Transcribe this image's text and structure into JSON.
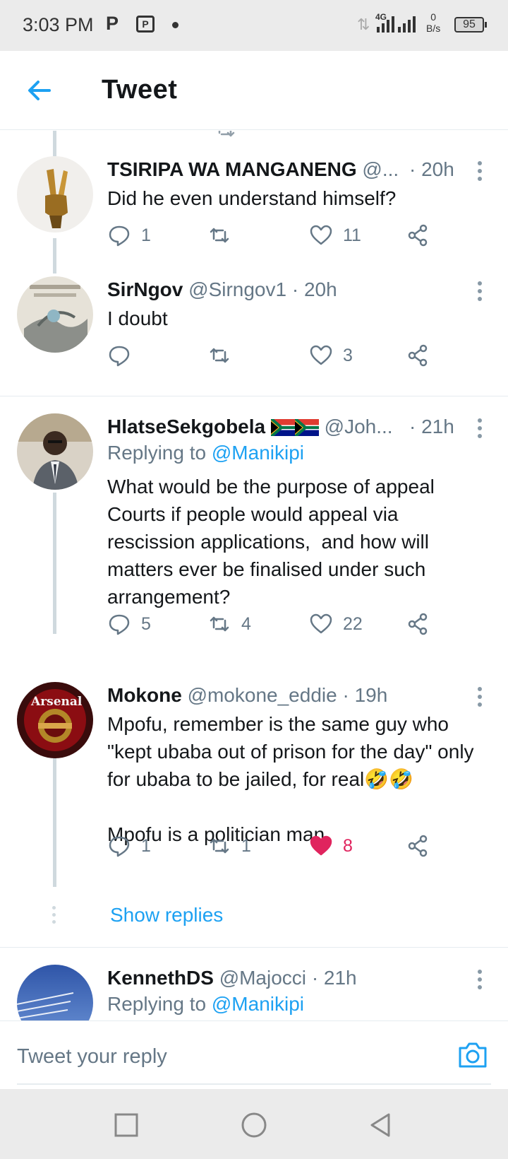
{
  "status_bar": {
    "time": "3:03 PM",
    "p_icon": "P",
    "network": "4G",
    "speed_value": "0",
    "speed_unit": "B/s",
    "battery": "95"
  },
  "header": {
    "title": "Tweet",
    "back_icon": "arrow-left-icon"
  },
  "tweets": [
    {
      "name": "TSIRIPA WA MANGANENG",
      "handle": "@...",
      "time": "· 20h",
      "text": "Did he even understand himself?",
      "replies": "1",
      "retweets": "",
      "likes": "11"
    },
    {
      "name": "SirNgov",
      "handle": "@Sirngov1",
      "time": "· 20h",
      "text": "I doubt",
      "replies": "",
      "retweets": "",
      "likes": "3"
    },
    {
      "name": "HlatseSekgobela",
      "handle": "@Joh...",
      "time": "· 21h",
      "replying_prefix": "Replying to",
      "replying_mention": "@Manikipi",
      "text": "What would be the purpose of appeal Courts if people would appeal via rescission applications,  and how will matters ever be finalised under such arrangement?",
      "replies": "5",
      "retweets": "4",
      "likes": "22"
    },
    {
      "name": "Mokone",
      "handle": "@mokone_eddie",
      "time": "· 19h",
      "text": "Mpofu, remember is the same guy who \"kept ubaba out of prison for the day\" only for ubaba to be jailed, for real🤣🤣\n\nMpofu is a politician man",
      "replies": "1",
      "retweets": "1",
      "likes": "8",
      "liked": true,
      "avatar_text": "Arsenal"
    },
    {
      "name": "KennethDS",
      "handle": "@Majocci",
      "time": "· 21h",
      "replying_prefix": "Replying to",
      "replying_mention": "@Manikipi"
    }
  ],
  "show_replies": "Show replies",
  "reply_bar": {
    "placeholder": "Tweet your reply",
    "camera_icon": "camera-icon"
  },
  "colors": {
    "accent": "#1da1f2",
    "like": "#e0245e",
    "muted": "#657786"
  }
}
